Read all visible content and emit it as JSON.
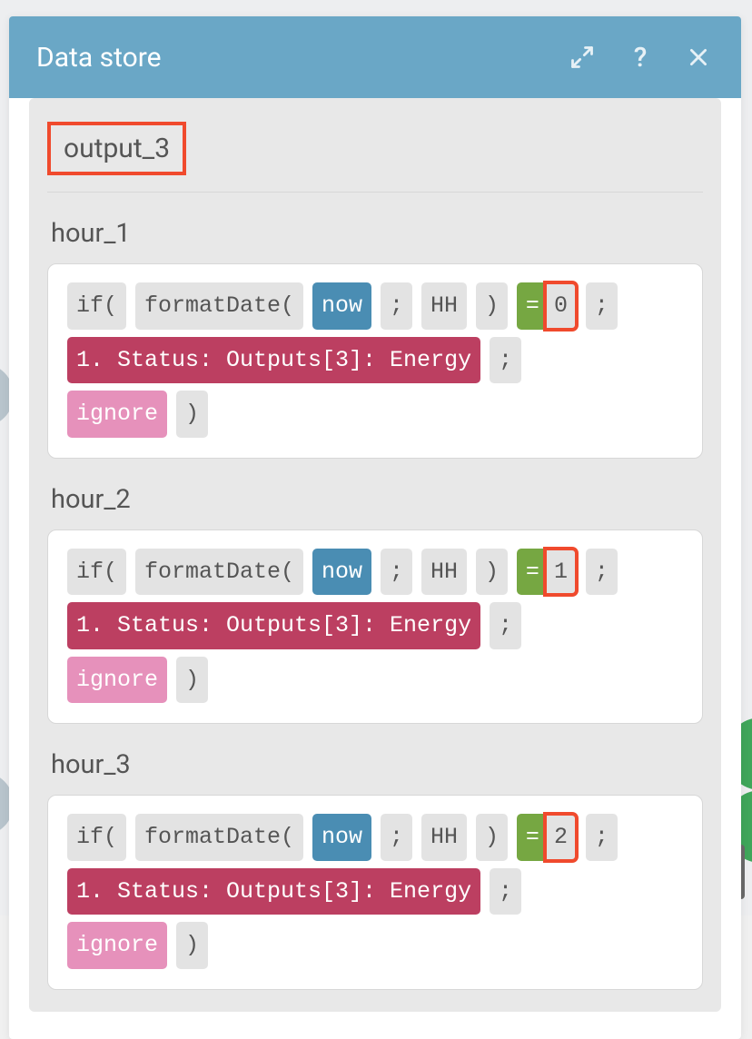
{
  "header": {
    "title": "Data store"
  },
  "section": {
    "title": "output_3"
  },
  "fields": [
    {
      "label": "hour_1",
      "expr": {
        "if": "if(",
        "formatDate": "formatDate(",
        "now": "now",
        "sep1": ";",
        "hh": "HH",
        "close1": ")",
        "eq": "=",
        "eqVal": "0",
        "sep2": ";",
        "status": "1. Status: Outputs[3]: Energy",
        "sep3": ";",
        "ignore": "ignore",
        "close2": ")"
      }
    },
    {
      "label": "hour_2",
      "expr": {
        "if": "if(",
        "formatDate": "formatDate(",
        "now": "now",
        "sep1": ";",
        "hh": "HH",
        "close1": ")",
        "eq": "=",
        "eqVal": "1",
        "sep2": ";",
        "status": "1. Status: Outputs[3]: Energy",
        "sep3": ";",
        "ignore": "ignore",
        "close2": ")"
      }
    },
    {
      "label": "hour_3",
      "expr": {
        "if": "if(",
        "formatDate": "formatDate(",
        "now": "now",
        "sep1": ";",
        "hh": "HH",
        "close1": ")",
        "eq": "=",
        "eqVal": "2",
        "sep2": ";",
        "status": "1. Status: Outputs[3]: Energy",
        "sep3": ";",
        "ignore": "ignore",
        "close2": ")"
      }
    }
  ]
}
